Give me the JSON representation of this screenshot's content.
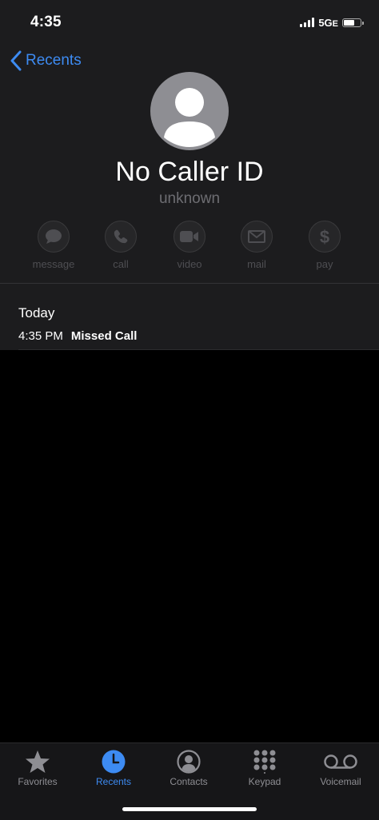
{
  "status_bar": {
    "time": "4:35",
    "network": "5G",
    "network_suffix": "E"
  },
  "nav": {
    "back_label": "Recents"
  },
  "contact": {
    "name": "No Caller ID",
    "subtitle": "unknown"
  },
  "actions": [
    {
      "label": "message",
      "icon": "message-icon"
    },
    {
      "label": "call",
      "icon": "phone-icon"
    },
    {
      "label": "video",
      "icon": "video-icon"
    },
    {
      "label": "mail",
      "icon": "mail-icon"
    },
    {
      "label": "pay",
      "icon": "dollar-icon"
    }
  ],
  "history": {
    "section_title": "Today",
    "calls": [
      {
        "time": "4:35 PM",
        "type": "Missed Call"
      }
    ]
  },
  "tab_bar": {
    "tabs": [
      {
        "label": "Favorites",
        "icon": "star-icon",
        "active": false
      },
      {
        "label": "Recents",
        "icon": "clock-icon",
        "active": true
      },
      {
        "label": "Contacts",
        "icon": "person-circle-icon",
        "active": false
      },
      {
        "label": "Keypad",
        "icon": "keypad-icon",
        "active": false
      },
      {
        "label": "Voicemail",
        "icon": "voicemail-icon",
        "active": false
      }
    ]
  },
  "colors": {
    "accent": "#3d8bf2",
    "header_bg": "#1c1c1e",
    "disabled": "#4e4e52"
  }
}
